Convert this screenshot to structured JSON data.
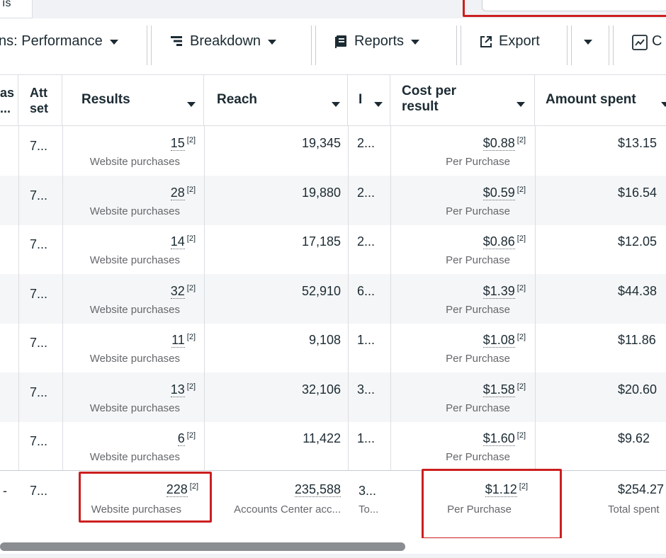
{
  "top": {
    "tab_label": "ıs"
  },
  "toolbar": {
    "columns_label": "ns: Performance",
    "breakdown_label": "Breakdown",
    "reports_label": "Reports",
    "export_label": "Export",
    "chart_label": "C"
  },
  "columns": {
    "c0": [
      "as",
      "..."
    ],
    "c1": [
      "Att",
      "set"
    ],
    "results": "Results",
    "reach": "Reach",
    "impressions": "I",
    "cost": [
      "Cost per",
      "result"
    ],
    "spent": "Amount spent"
  },
  "rows": [
    {
      "attr": "7...",
      "results": "15",
      "results_sub": "Website purchases",
      "reach": "19,345",
      "impr": "2...",
      "cost": "$0.88",
      "cost_sub": "Per Purchase",
      "spent": "$13.15"
    },
    {
      "attr": "7...",
      "results": "28",
      "results_sub": "Website purchases",
      "reach": "19,880",
      "impr": "2...",
      "cost": "$0.59",
      "cost_sub": "Per Purchase",
      "spent": "$16.54"
    },
    {
      "attr": "7...",
      "results": "14",
      "results_sub": "Website purchases",
      "reach": "17,185",
      "impr": "2...",
      "cost": "$0.86",
      "cost_sub": "Per Purchase",
      "spent": "$12.05"
    },
    {
      "attr": "7...",
      "results": "32",
      "results_sub": "Website purchases",
      "reach": "52,910",
      "impr": "6...",
      "cost": "$1.39",
      "cost_sub": "Per Purchase",
      "spent": "$44.38"
    },
    {
      "attr": "7...",
      "results": "11",
      "results_sub": "Website purchases",
      "reach": "9,108",
      "impr": "1...",
      "cost": "$1.08",
      "cost_sub": "Per Purchase",
      "spent": "$11.86"
    },
    {
      "attr": "7...",
      "results": "13",
      "results_sub": "Website purchases",
      "reach": "32,106",
      "impr": "3...",
      "cost": "$1.58",
      "cost_sub": "Per Purchase",
      "spent": "$20.60"
    },
    {
      "attr": "7...",
      "results": "6",
      "results_sub": "Website purchases",
      "reach": "11,422",
      "impr": "1...",
      "cost": "$1.60",
      "cost_sub": "Per Purchase",
      "spent": "$9.62"
    }
  ],
  "footnote_marker": "[2]",
  "totals": {
    "c0": "-",
    "attr": "7...",
    "results": "228",
    "results_sub": "Website purchases",
    "reach": "235,588",
    "reach_sub": "Accounts Center acc...",
    "impr": "3...",
    "impr_sub": "To...",
    "cost": "$1.12",
    "cost_sub": "Per Purchase",
    "spent": "$254.27",
    "spent_sub": "Total spent"
  },
  "colors": {
    "highlight": "#cc1f1f",
    "alt_row": "#f5f6f7",
    "border": "#dadde1"
  }
}
